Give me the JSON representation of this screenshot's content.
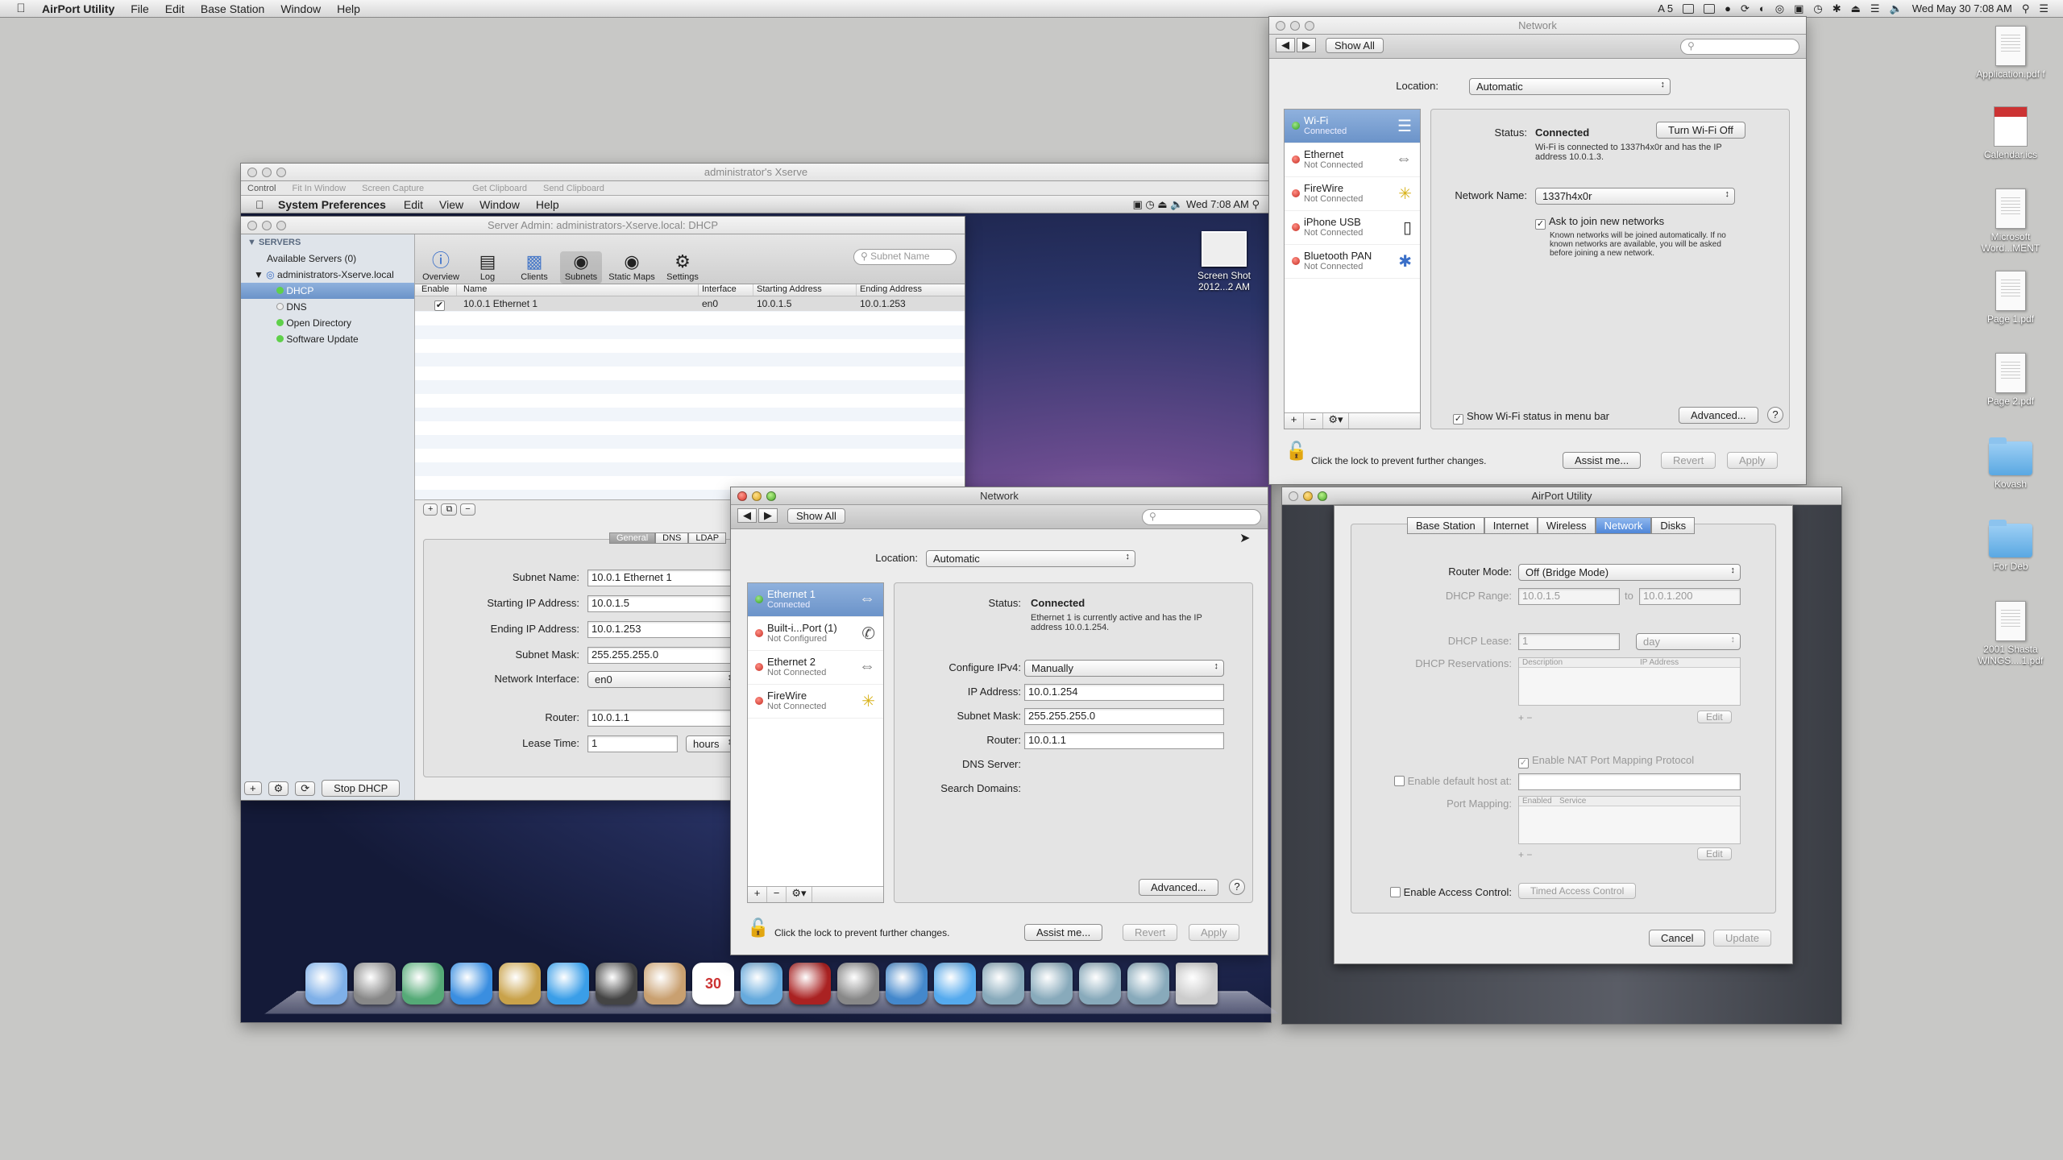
{
  "menubar": {
    "app": "AirPort Utility",
    "items": [
      "File",
      "Edit",
      "Base Station",
      "Window",
      "Help"
    ],
    "right_status": "5",
    "clock": "Wed May 30  7:08 AM"
  },
  "desktop": {
    "icons": [
      {
        "label": "Application.pdf f",
        "type": "doc"
      },
      {
        "label": "Calendar.ics",
        "type": "cal"
      },
      {
        "label": "Microsoft Word...MENT",
        "type": "doc"
      },
      {
        "label": "Page 1.pdf",
        "type": "doc"
      },
      {
        "label": "Page 2.pdf",
        "type": "doc"
      },
      {
        "label": "Kovash",
        "type": "folder"
      },
      {
        "label": "For Deb",
        "type": "folder"
      },
      {
        "label": "2001 Shasta WINGS....1.pdf",
        "type": "doc"
      }
    ]
  },
  "xserve": {
    "title": "administrator's Xserve",
    "toolbar": [
      "Control",
      "Fit In Window",
      "Screen Capture",
      "Get Clipboard",
      "Send Clipboard"
    ],
    "remote_menubar": {
      "app": "System Preferences",
      "items": [
        "Edit",
        "View",
        "Window",
        "Help"
      ],
      "clock": "Wed 7:08 AM"
    },
    "screenshot_label": "Screen Shot 2012...2 AM"
  },
  "server_admin": {
    "title": "Server Admin: administrators-Xserve.local: DHCP",
    "sidebar_header": "SERVERS",
    "available": "Available Servers (0)",
    "server": "administrators-Xserve.local",
    "services": [
      "DHCP",
      "DNS",
      "Open Directory",
      "Software Update"
    ],
    "toolbar": [
      "Overview",
      "Log",
      "Clients",
      "Subnets",
      "Static Maps",
      "Settings"
    ],
    "search_placeholder": "Subnet Name",
    "columns": [
      "Enable",
      "Name",
      "Interface",
      "Starting Address",
      "Ending Address"
    ],
    "row": {
      "enabled": "✔",
      "name": "10.0.1 Ethernet 1",
      "interface": "en0",
      "start": "10.0.1.5",
      "end": "10.0.1.253"
    },
    "tabs": [
      "General",
      "DNS",
      "LDAP"
    ],
    "form": {
      "subnet_name_label": "Subnet Name:",
      "subnet_name": "10.0.1 Ethernet 1",
      "start_label": "Starting IP Address:",
      "start": "10.0.1.5",
      "end_label": "Ending IP Address:",
      "end": "10.0.1.253",
      "mask_label": "Subnet Mask:",
      "mask": "255.255.255.0",
      "iface_label": "Network Interface:",
      "iface": "en0",
      "router_label": "Router:",
      "router": "10.0.1.1",
      "lease_label": "Lease Time:",
      "lease": "1",
      "lease_unit": "hours"
    },
    "stop_button": "Stop DHCP"
  },
  "network_top": {
    "title": "Network",
    "show_all": "Show All",
    "location_label": "Location:",
    "location": "Automatic",
    "services": [
      {
        "name": "Wi-Fi",
        "status": "Connected",
        "dot": "green"
      },
      {
        "name": "Ethernet",
        "status": "Not Connected",
        "dot": "red"
      },
      {
        "name": "FireWire",
        "status": "Not Connected",
        "dot": "red"
      },
      {
        "name": "iPhone USB",
        "status": "Not Connected",
        "dot": "red"
      },
      {
        "name": "Bluetooth PAN",
        "status": "Not Connected",
        "dot": "red"
      }
    ],
    "status_label": "Status:",
    "status": "Connected",
    "turn_off": "Turn Wi-Fi Off",
    "status_desc": "Wi-Fi is connected to 1337h4x0r and has the IP address 10.0.1.3.",
    "network_name_label": "Network Name:",
    "network_name": "1337h4x0r",
    "ask_join": "Ask to join new networks",
    "ask_join_desc": "Known networks will be joined automatically. If no known networks are available, you will be asked before joining a new network.",
    "show_status": "Show Wi-Fi status in menu bar",
    "advanced": "Advanced...",
    "lock_text": "Click the lock to prevent further changes.",
    "assist": "Assist me...",
    "revert": "Revert",
    "apply": "Apply"
  },
  "network_mid": {
    "title": "Network",
    "show_all": "Show All",
    "location_label": "Location:",
    "location": "Automatic",
    "services": [
      {
        "name": "Ethernet 1",
        "status": "Connected",
        "dot": "green"
      },
      {
        "name": "Built-i...Port (1)",
        "status": "Not Configured",
        "dot": "red"
      },
      {
        "name": "Ethernet 2",
        "status": "Not Connected",
        "dot": "red"
      },
      {
        "name": "FireWire",
        "status": "Not Connected",
        "dot": "red"
      }
    ],
    "status_label": "Status:",
    "status": "Connected",
    "status_desc": "Ethernet 1 is currently active and has the IP address 10.0.1.254.",
    "configure_label": "Configure IPv4:",
    "configure": "Manually",
    "ip_label": "IP Address:",
    "ip": "10.0.1.254",
    "mask_label": "Subnet Mask:",
    "mask": "255.255.255.0",
    "router_label": "Router:",
    "router": "10.0.1.1",
    "dns_label": "DNS Server:",
    "search_label": "Search Domains:",
    "advanced": "Advanced...",
    "lock_text": "Click the lock to prevent further changes.",
    "assist": "Assist me...",
    "revert": "Revert",
    "apply": "Apply"
  },
  "airport": {
    "title": "AirPort Utility",
    "tabs": [
      "Base Station",
      "Internet",
      "Wireless",
      "Network",
      "Disks"
    ],
    "selected_tab": "Network",
    "router_mode_label": "Router Mode:",
    "router_mode": "Off (Bridge Mode)",
    "dhcp_range_label": "DHCP Range:",
    "dhcp_start": "10.0.1.5",
    "to": "to",
    "dhcp_end": "10.0.1.200",
    "lease_label": "DHCP Lease:",
    "lease": "1",
    "lease_unit": "day",
    "reservations_label": "DHCP Reservations:",
    "res_cols": [
      "Description",
      "IP Address"
    ],
    "edit": "Edit",
    "nat_pmp": "Enable NAT Port Mapping Protocol",
    "default_host": "Enable default host at:",
    "port_mapping_label": "Port Mapping:",
    "pm_cols": [
      "Enabled",
      "Service"
    ],
    "access_control": "Enable Access Control:",
    "timed_access": "Timed Access Control",
    "cancel": "Cancel",
    "update": "Update"
  },
  "dock": {
    "apps": [
      "Finder",
      "Launchpad",
      "Server Admin",
      "App Store",
      "Preview",
      "Safari",
      "Photo Booth",
      "Address Book",
      "Calendar",
      "iTunes",
      "Photo Booth",
      "System Preferences",
      "Network Utility",
      "Remote Desktop",
      "Applications",
      "Utilities",
      "Documents",
      "Downloads",
      "Trash"
    ],
    "calendar_day": "30"
  }
}
